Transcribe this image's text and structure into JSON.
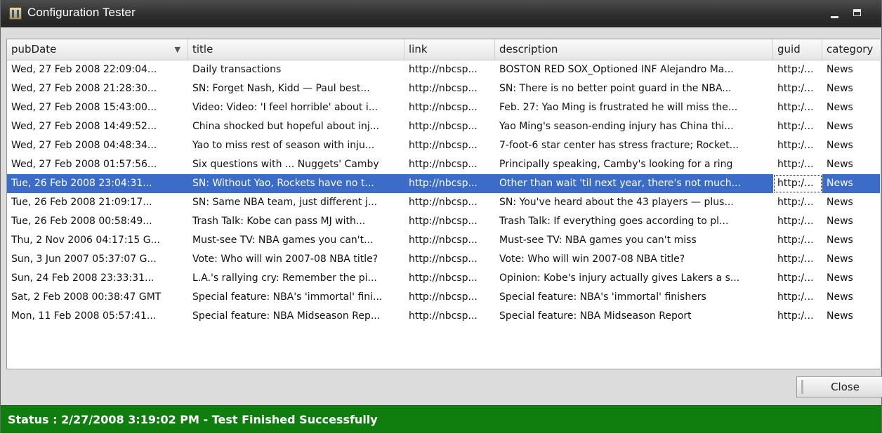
{
  "window": {
    "title": "Configuration Tester",
    "icon": "app-icon"
  },
  "columns": [
    "pubDate",
    "title",
    "link",
    "description",
    "guid",
    "category"
  ],
  "sort": {
    "column": "pubDate",
    "indicator": "▼"
  },
  "rows": [
    {
      "pubDate": "Wed, 27 Feb 2008 22:09:04...",
      "title": "Daily transactions",
      "link": "http://nbcsp...",
      "description": "BOSTON RED SOX_Optioned INF Alejandro Ma...",
      "guid": "http:/...",
      "category": "News"
    },
    {
      "pubDate": "Wed, 27 Feb 2008 21:28:30...",
      "title": "SN: Forget Nash, Kidd — Paul best...",
      "link": "http://nbcsp...",
      "description": "SN: There is no better point guard in the NBA...",
      "guid": "http:/...",
      "category": "News"
    },
    {
      "pubDate": "Wed, 27 Feb 2008 15:43:00...",
      "title": "Video: Video: 'I feel horrible' about i...",
      "link": "http://nbcsp...",
      "description": "Feb. 27: Yao Ming is frustrated he will miss the...",
      "guid": "http:/...",
      "category": "News"
    },
    {
      "pubDate": "Wed, 27 Feb 2008 14:49:52...",
      "title": "China shocked but hopeful about inj...",
      "link": "http://nbcsp...",
      "description": "Yao Ming's season-ending injury has China thi...",
      "guid": "http:/...",
      "category": "News"
    },
    {
      "pubDate": "Wed, 27 Feb 2008 04:48:34...",
      "title": "Yao to miss rest of season with inju...",
      "link": "http://nbcsp...",
      "description": "7-foot-6 star center has stress fracture; Rocket...",
      "guid": "http:/...",
      "category": "News"
    },
    {
      "pubDate": "Wed, 27 Feb 2008 01:57:56...",
      "title": "Six questions with ... Nuggets' Camby",
      "link": "http://nbcsp...",
      "description": "Principally speaking, Camby's looking for a ring",
      "guid": "http:/...",
      "category": "News"
    },
    {
      "pubDate": "Tue, 26 Feb 2008 23:04:31...",
      "title": "SN: Without Yao, Rockets have no t...",
      "link": "http://nbcsp...",
      "description": "Other than wait 'til next year, there's not much...",
      "guid": "http:/...",
      "category": "News"
    },
    {
      "pubDate": "Tue, 26 Feb 2008 21:09:17...",
      "title": "SN: Same NBA team, just different j...",
      "link": "http://nbcsp...",
      "description": "SN: You've heard about the 43 players — plus...",
      "guid": "http:/...",
      "category": "News"
    },
    {
      "pubDate": "Tue, 26 Feb 2008 00:58:49...",
      "title": "Trash Talk: Kobe can pass MJ with...",
      "link": "http://nbcsp...",
      "description": "Trash Talk:  If everything goes according to pl...",
      "guid": "http:/...",
      "category": "News"
    },
    {
      "pubDate": "Thu, 2 Nov 2006 04:17:15 G...",
      "title": "Must-see TV: NBA games you can't...",
      "link": "http://nbcsp...",
      "description": "Must-see TV: NBA games you can't miss",
      "guid": "http:/...",
      "category": "News"
    },
    {
      "pubDate": "Sun, 3 Jun 2007 05:37:07 G...",
      "title": "Vote: Who will win 2007-08 NBA title?",
      "link": "http://nbcsp...",
      "description": "Vote: Who will win 2007-08 NBA title?",
      "guid": "http:/...",
      "category": "News"
    },
    {
      "pubDate": "Sun, 24 Feb 2008 23:33:31...",
      "title": "L.A.'s rallying cry: Remember the pi...",
      "link": "http://nbcsp...",
      "description": "Opinion: Kobe's injury actually gives Lakers a s...",
      "guid": "http:/...",
      "category": "News"
    },
    {
      "pubDate": "Sat, 2 Feb 2008 00:38:47 GMT",
      "title": "Special feature: NBA's 'immortal' fini...",
      "link": "http://nbcsp...",
      "description": "Special feature: NBA's 'immortal' finishers",
      "guid": "http:/...",
      "category": "News"
    },
    {
      "pubDate": "Mon, 11 Feb 2008 05:57:41...",
      "title": "Special feature: NBA Midseason Rep...",
      "link": "http://nbcsp...",
      "description": "Special feature: NBA Midseason Report",
      "guid": "http:/...",
      "category": "News"
    }
  ],
  "selected_row": 6,
  "buttons": {
    "close": "Close"
  },
  "status": {
    "text": "Status : 2/27/2008 3:19:02 PM - Test Finished Successfully"
  },
  "colors": {
    "selection": "#3b6cc7",
    "status_bar": "#0f7e0f",
    "titlebar": "#2e2e2e"
  }
}
